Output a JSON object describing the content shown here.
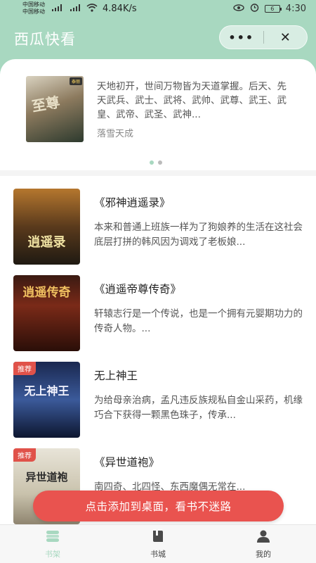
{
  "status_bar": {
    "carrier_1": "中国移动",
    "carrier_2": "中国移动",
    "speed": "4.84K/s",
    "battery": "6",
    "time": "4:30"
  },
  "header": {
    "title": "西瓜快看",
    "more_label": "•••",
    "close_label": "✕"
  },
  "featured": {
    "cover_tag": "泰丽",
    "cover_text": "至尊",
    "description": "天地初开，世间万物皆为天道掌握。后天、先天武兵、武士、武将、武帅、武尊、武王、武皇、武帝、武圣、武神...",
    "author": "落雪天成",
    "pages": 2,
    "active_page": 1
  },
  "books": [
    {
      "title": "《邪神逍遥录》",
      "description": "本来和普通上班族一样为了狗娘养的生活在这社会底层打拼的韩风因为调戏了老板娘...",
      "cover_text": "逍遥录",
      "badge": ""
    },
    {
      "title": "《逍遥帝尊传奇》",
      "description": "轩辕志行是一个传说，也是一个拥有元婴期功力的传奇人物。...",
      "cover_text": "逍遥传奇",
      "badge": ""
    },
    {
      "title": "无上神王",
      "description": "为给母亲治病，孟凡违反族规私自金山采药，机缘巧合下获得一颗黑色珠子，传承...",
      "cover_text": "无上神王",
      "badge": "推荐"
    },
    {
      "title": "《异世道袍》",
      "description": "南四奇、北四怪、东西魔偶无常在...",
      "cover_text": "异世道袍",
      "badge": "推荐"
    }
  ],
  "cta_label": "点击添加到桌面，看书不迷路",
  "tabbar": {
    "items": [
      {
        "label": "书架",
        "icon": "bookshelf-icon",
        "active": true
      },
      {
        "label": "书城",
        "icon": "book-icon",
        "active": false
      },
      {
        "label": "我的",
        "icon": "user-icon",
        "active": false
      }
    ]
  },
  "colors": {
    "accent": "#a8d8c0",
    "cta": "#e9534f",
    "badge": "#e0524a"
  }
}
